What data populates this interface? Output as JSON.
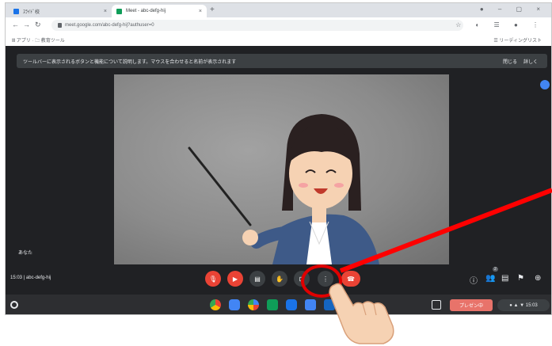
{
  "browser": {
    "tabs": [
      {
        "label": "ｽﾗｲﾄﾞ校",
        "fav_color": "#1a73e8"
      },
      {
        "label": "Meet - abc-defg-hij",
        "fav_color": "#0f9d58"
      }
    ],
    "tab_close": "×",
    "new_tab": "+",
    "window_controls": "● – ▢ ×",
    "url": "meet.google.com/abc-defg-hij?authuser=0",
    "toolbar_icons": "☆ ◐ ☰ ● ⋮",
    "bookmarks_left": "Ⅲ アプリ  ·  🗀 教育ツール",
    "bookmarks_right": "☰ リーディングリスト"
  },
  "meet": {
    "notice": "ツールバーに表示されるボタンと機能について説明します。マウスを合わせると名前が表示されます",
    "notice_action1": "閉じる",
    "notice_action2": "詳しく",
    "self_name": "あなた",
    "meeting_info": "15:03 | abc-defg-hij",
    "controls": [
      {
        "name": "mic",
        "label": "🎙",
        "style": "red"
      },
      {
        "name": "camera",
        "label": "▶",
        "style": "red"
      },
      {
        "name": "captions",
        "label": "▤",
        "style": "grey"
      },
      {
        "name": "raise-hand",
        "label": "✋",
        "style": "grey"
      },
      {
        "name": "present",
        "label": "⊡",
        "style": "grey"
      },
      {
        "name": "more-options",
        "label": "⋮",
        "style": "grey"
      },
      {
        "name": "leave-call",
        "label": "☎",
        "style": "red"
      }
    ],
    "right_icons": [
      "ⓘ",
      "👥",
      "▤",
      "⚑",
      "⊕"
    ],
    "participant_count": "2"
  },
  "shelf": {
    "apps": [
      {
        "name": "chrome",
        "color": "#fbbc05"
      },
      {
        "name": "files",
        "color": "#4285f4"
      },
      {
        "name": "google",
        "color": "#34a853"
      },
      {
        "name": "meet",
        "color": "#0f9d58"
      },
      {
        "name": "classroom",
        "color": "#4285f4"
      },
      {
        "name": "docs",
        "color": "#1a73e8"
      }
    ],
    "pill_label": "プレゼン中",
    "status_text": "● ▲ ▼ 15:03"
  }
}
